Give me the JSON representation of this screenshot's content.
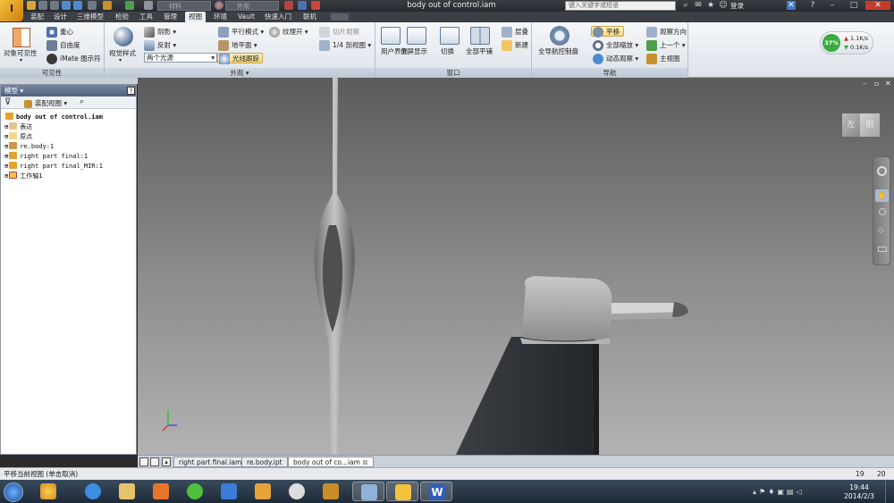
{
  "window": {
    "title": "body out of control.iam",
    "search_placeholder": "键入关键字或短语",
    "login": "登录",
    "quick_material": "材料",
    "quick_appearance": "外观"
  },
  "tabs": [
    "装配",
    "设计",
    "三维模型",
    "检验",
    "工具",
    "管理",
    "视图",
    "环境",
    "Vault",
    "快速入门",
    "联机"
  ],
  "active_tab": "视图",
  "ribbon": {
    "visibility": {
      "title": "可见性",
      "object_visibility": "对象可见性",
      "center_of_gravity": "重心",
      "dof": "自由度",
      "imate": "iMate 图示符"
    },
    "appearance": {
      "title": "外观",
      "visual_style": "视觉样式",
      "shadows": "阴影",
      "reflection": "反射",
      "lighting": "两个光源",
      "parallel": "平行模式",
      "ground_plane": "地平面",
      "ray_tracing": "光线跟踪",
      "texture": "纹理开",
      "section": "切片观察",
      "quarter_section": "1/4 剖视图"
    },
    "window": {
      "title": "窗口",
      "user_interface": "用户界面",
      "fullscreen": "全屏显示",
      "switch": "切换",
      "tile_all": "全部平铺",
      "cascade": "层叠",
      "new": "新建"
    },
    "navigate": {
      "title": "导航",
      "full_nav_wheel": "全导航控制盘",
      "pan": "平移",
      "zoom_all": "全部缩放",
      "orbit": "动态观察",
      "view_face": "观察方向",
      "previous": "上一个",
      "home": "主视图"
    }
  },
  "network": {
    "percent": "37%",
    "up": "1.1K/s",
    "down": "0.1K/s"
  },
  "browser": {
    "header": "模型",
    "view_dropdown": "装配视图",
    "tree": [
      {
        "label": "body out of control.iam",
        "root": true,
        "icon": "assembly"
      },
      {
        "label": "表达",
        "icon": "folder"
      },
      {
        "label": "原点",
        "icon": "folder"
      },
      {
        "label": "re.body:1",
        "icon": "part"
      },
      {
        "label": "right part final:1",
        "icon": "assembly"
      },
      {
        "label": "right part final_MIR:1",
        "icon": "assembly"
      },
      {
        "label": "工作轴1",
        "icon": "axis"
      }
    ]
  },
  "viewcube": {
    "left": "左",
    "front": "前"
  },
  "doc_tabs": [
    {
      "label": "right part final.iam",
      "active": false
    },
    {
      "label": "re.body.ipt",
      "active": false
    },
    {
      "label": "body out of co...iam",
      "active": true
    }
  ],
  "status": {
    "message": "平移当前视图 (单击取消)",
    "n1": "19",
    "n2": "20"
  },
  "taskbar": {
    "time": "19:44",
    "date": "2014/2/3"
  },
  "colors": {
    "ribbon_accent": "#c8a64a",
    "part_dark": "#2d3033",
    "part_light": "#9b9b9b",
    "taskbar": "#1e2a38"
  }
}
